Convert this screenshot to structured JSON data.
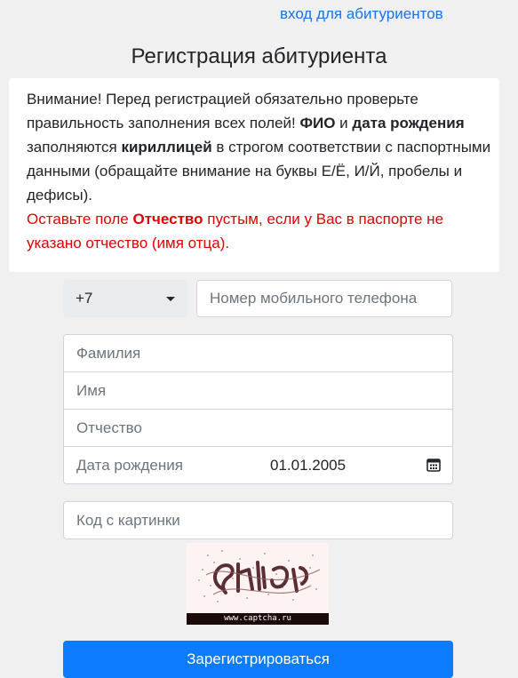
{
  "header": {
    "login_link": "вход для абитуриентов",
    "title": "Регистрация абитуриента"
  },
  "notice": {
    "p1_a": "Внимание! Перед регистрацией обязательно проверьте правильность заполнения всех полей! ",
    "p1_b1": "ФИО",
    "p1_c": " и ",
    "p1_b2": "дата рождения",
    "p1_d": " заполняются ",
    "p1_b3": "кириллицей",
    "p1_e": " в строгом соответствии с паспортными данными (обращайте внимание на буквы Е/Ё, И/Й, пробелы и дефисы).",
    "p2_a": "Оставьте поле ",
    "p2_b": "Отчество",
    "p2_c": " пустым, если у Вас в паспорте не указано отчество (имя отца)."
  },
  "form": {
    "phone_prefix": "+7",
    "phone_placeholder": "Номер мобильного телефона",
    "last_name_placeholder": "Фамилия",
    "first_name_placeholder": "Имя",
    "middle_name_placeholder": "Отчество",
    "dob_label": "Дата рождения",
    "dob_value": "01.01.2005",
    "captcha_placeholder": "Код с картинки",
    "captcha_caption": "www.captcha.ru",
    "submit_label": "Зарегистрироваться"
  },
  "icons": {
    "dob": "calendar-icon",
    "prefix": "chevron-down-icon"
  },
  "colors": {
    "link": "#1a73e8",
    "warning": "#e00000",
    "primary": "#0d7bfd"
  }
}
